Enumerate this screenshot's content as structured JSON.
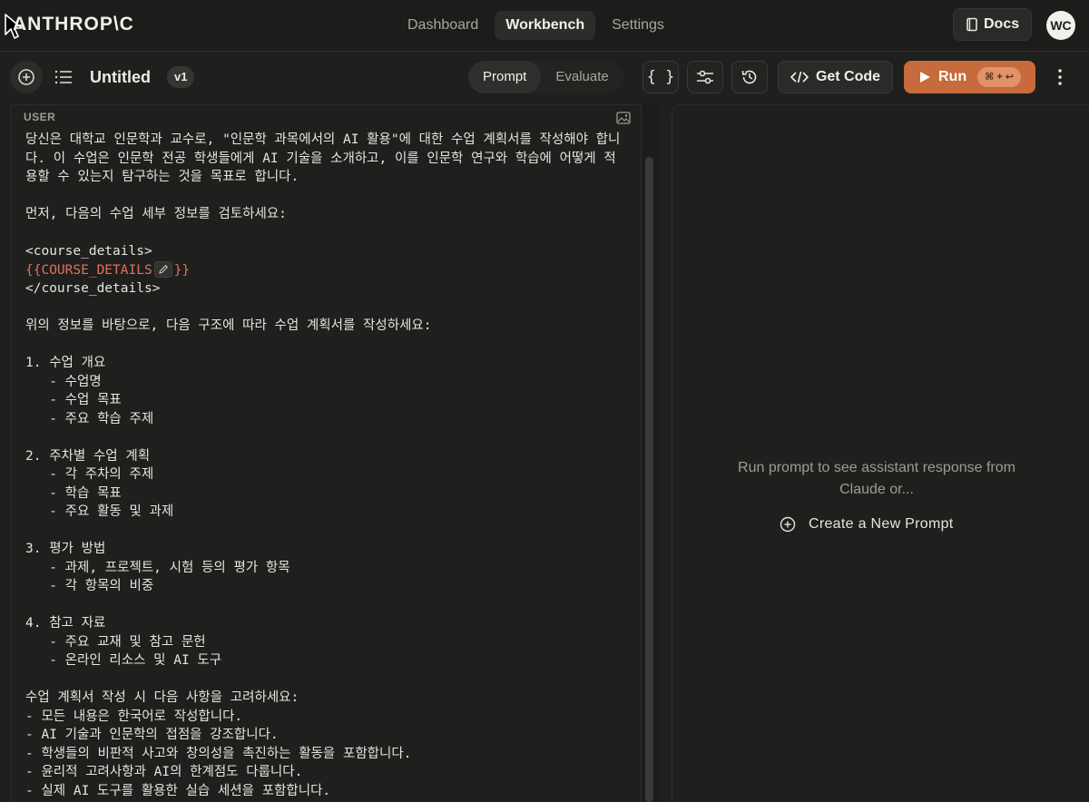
{
  "nav": {
    "logo": "ANTHROP\\C",
    "tabs": [
      "Dashboard",
      "Workbench",
      "Settings"
    ],
    "docs_label": "Docs",
    "avatar_initials": "WC"
  },
  "toolbar": {
    "title": "Untitled",
    "version": "v1",
    "modes": [
      "Prompt",
      "Evaluate"
    ],
    "variables_icon": "{ }",
    "get_code_label": "Get Code",
    "run_label": "Run",
    "run_shortcut": "⌘ + ↩"
  },
  "editor": {
    "role_label": "USER",
    "intro": "당신은 대학교 인문학과 교수로, \"인문학 과목에서의 AI 활용\"에 대한 수업 계획서를 작성해야 합니다. 이 수업은 인문학 전공 학생들에게 AI 기술을 소개하고, 이를 인문학 연구와 학습에 어떻게 적용할 수 있는지 탐구하는 것을 목표로 합니다.\n\n먼저, 다음의 수업 세부 정보를 검토하세요:\n\n<course_details>",
    "variable": "{{COURSE_DETAILS",
    "variable_close": "}}",
    "rest": "</course_details>\n\n위의 정보를 바탕으로, 다음 구조에 따라 수업 계획서를 작성하세요:\n\n1. 수업 개요\n   - 수업명\n   - 수업 목표\n   - 주요 학습 주제\n\n2. 주차별 수업 계획\n   - 각 주차의 주제\n   - 학습 목표\n   - 주요 활동 및 과제\n\n3. 평가 방법\n   - 과제, 프로젝트, 시험 등의 평가 항목\n   - 각 항목의 비중\n\n4. 참고 자료\n   - 주요 교재 및 참고 문헌\n   - 온라인 리소스 및 AI 도구\n\n수업 계획서 작성 시 다음 사항을 고려하세요:\n- 모든 내용은 한국어로 작성합니다.\n- AI 기술과 인문학의 접점을 강조합니다.\n- 학생들의 비판적 사고와 창의성을 촉진하는 활동을 포함합니다.\n- 윤리적 고려사항과 AI의 한계점도 다룹니다.\n- 실제 AI 도구를 활용한 실습 세션을 포함합니다."
  },
  "response": {
    "empty_message": "Run prompt to see assistant response from Claude or...",
    "new_prompt_label": "Create a New Prompt"
  },
  "colors": {
    "background": "#1f1f1e",
    "run_button": "#c76a3c",
    "variable": "#e2705b"
  }
}
